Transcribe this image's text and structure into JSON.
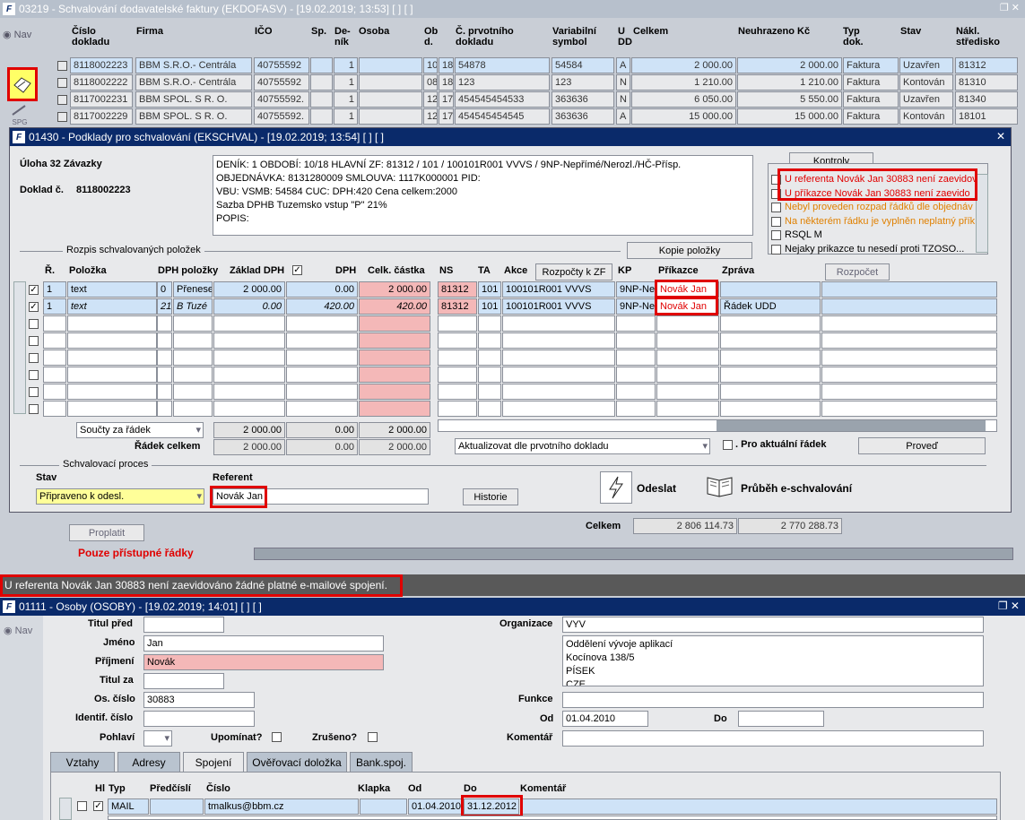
{
  "w1": {
    "title": "03219 - Schvalování dodavatelské faktury (EKDOFASV) - [19.02.2019; 13:53]  [ ]  [ ]",
    "nav": "Nav",
    "cols": [
      "Číslo dokladu",
      "Firma",
      "IČO",
      "Sp.",
      "De-ník",
      "Osoba",
      "Ob d.",
      "Č. prvotního dokladu",
      "Variabilní symbol",
      "U DD",
      "Celkem",
      "Neuhrazeno Kč",
      "Typ dok.",
      "Stav",
      "Nákl. středisko"
    ],
    "rows": [
      [
        "8118002223",
        "BBM S.R.O.- Centrála",
        "40755592",
        "",
        "1",
        "",
        "10",
        "18",
        "54878",
        "54584",
        "A",
        "2 000.00",
        "2 000.00",
        "Faktura",
        "Uzavřen",
        "81312"
      ],
      [
        "8118002222",
        "BBM S.R.O.- Centrála",
        "40755592",
        "",
        "1",
        "",
        "08",
        "18",
        "123",
        "123",
        "N",
        "1 210.00",
        "1 210.00",
        "Faktura",
        "Kontován",
        "81310"
      ],
      [
        "8117002231",
        "BBM SPOL. S R. O.",
        "40755592.",
        "",
        "1",
        "",
        "12",
        "17",
        "454545454533",
        "363636",
        "N",
        "6 050.00",
        "5 550.00",
        "Faktura",
        "Uzavřen",
        "81340"
      ],
      [
        "8117002229",
        "BBM SPOL. S R. O.",
        "40755592.",
        "",
        "1",
        "",
        "12",
        "17",
        "454545454545",
        "363636",
        "A",
        "15 000.00",
        "15 000.00",
        "Faktura",
        "Kontován",
        "18101"
      ]
    ],
    "spg": "SPG",
    "proplatit": "Proplatit",
    "pouze": "Pouze přístupné řádky",
    "celkem_lbl": "Celkem",
    "celkem1": "2 806 114.73",
    "celkem2": "2 770 288.73"
  },
  "w2": {
    "title": "01430 - Podklady pro schvalování (EKSCHVAL) - [19.02.2019; 13:54]  [ ]  [ ]",
    "uloha": "Úloha 32 Závazky",
    "doklad_lbl": "Doklad č.",
    "doklad": "8118002223",
    "info": [
      "DENÍK: 1   OBDOBÍ: 10/18   HLAVNÍ ZF: 81312 / 101 / 100101R001 VVVS / 9NP-Nepřímé/Nerozl./HČ-Přísp.",
      "OBJEDNÁVKA: 8131280009         SMLOUVA: 1117K000001          PID:",
      "VBU:                                  VSMB: 54584   CUC:                                    DPH:420    Cena celkem:2000",
      "Sazba DPHB  Tuzemsko vstup \"P\" 21%",
      "POPIS:"
    ],
    "kontroly": "Kontroly",
    "checks": [
      "U referenta Novák Jan 30883 není zaevidov",
      "U příkazce Novák Jan 30883 není zaevido",
      "Nebyl proveden rozpad řádků dle objednáv",
      "Na některém řádku je vyplněn neplatný příka",
      "RSQL M",
      "Nejaky prikazce tu nesedí proti TZOSO..."
    ],
    "rozpis": "Rozpis schvalovaných položek",
    "kopie": "Kopie položky",
    "rozpocty": "Rozpočty k ZF",
    "rozpocet": "Rozpočet",
    "cols": [
      "Ř.",
      "Položka",
      "DPH položky",
      "Základ DPH",
      "DPH",
      "Celk. částka",
      "NS",
      "TA",
      "Akce",
      "KP",
      "Příkazce",
      "Zpráva"
    ],
    "rows": [
      [
        "1",
        "text",
        "0",
        "Přenese",
        "2 000.00",
        "0.00",
        "2 000.00",
        "81312",
        "101",
        "100101R001 VVVS",
        "9NP-Nep",
        "Novák Jan",
        ""
      ],
      [
        "1",
        "text",
        "21",
        "B  Tuzé",
        "0.00",
        "420.00",
        "420.00",
        "81312",
        "101",
        "100101R001 VVVS",
        "9NP-Nep",
        "Novák Jan",
        "Řádek UDD"
      ]
    ],
    "soucty": "Součty za řádek",
    "sum": [
      "2 000.00",
      "0.00",
      "2 000.00"
    ],
    "radek_celkem": "Řádek celkem",
    "sum2": [
      "2 000.00",
      "0.00",
      "2 000.00"
    ],
    "aktualizovat": "Aktualizovat dle prvotního dokladu",
    "pro_akt": "Pro aktuální řádek",
    "proved": "Proveď",
    "proces": "Schvalovací proces",
    "stav_lbl": "Stav",
    "stav": "Připraveno k odesl.",
    "ref_lbl": "Referent",
    "ref": "Novák Jan",
    "historie": "Historie",
    "odeslat": "Odeslat",
    "prubeh": "Průběh e-schvalování"
  },
  "status": "U referenta Novák Jan 30883 není zaevidováno žádné platné e-mailové spojení.",
  "w3": {
    "title": "01111 - Osoby (OSOBY) - [19.02.2019; 14:01]  [ ]  [ ]",
    "nav": "Nav",
    "titul_pred": "Titul před",
    "jmeno_lbl": "Jméno",
    "jmeno": "Jan",
    "prijmeni_lbl": "Příjmení",
    "prijmeni": "Novák",
    "titul_za": "Titul za",
    "os_lbl": "Os. číslo",
    "os": "30883",
    "ident": "Identif. číslo",
    "pohlavi": "Pohlaví",
    "upominat": "Upomínat?",
    "zruseno": "Zrušeno?",
    "org_lbl": "Organizace",
    "org": "VYV",
    "addr": [
      "Oddělení vývoje aplikací",
      "Kocínova 138/5",
      "PÍSEK",
      "CZE"
    ],
    "funkce": "Funkce",
    "od_lbl": "Od",
    "od": "01.04.2010",
    "do_lbl": "Do",
    "komentar": "Komentář",
    "tabs": [
      "Vztahy",
      "Adresy",
      "Spojení",
      "Ověřovací doložka",
      "Bank.spoj."
    ],
    "cols": [
      "Hl",
      "Typ",
      "Předčíslí",
      "Číslo",
      "Klapka",
      "Od",
      "Do",
      "Komentář"
    ],
    "row": {
      "typ": "MAIL",
      "cislo": "tmalkus@bbm.cz",
      "od": "01.04.2010",
      "do": "31.12.2012"
    }
  }
}
